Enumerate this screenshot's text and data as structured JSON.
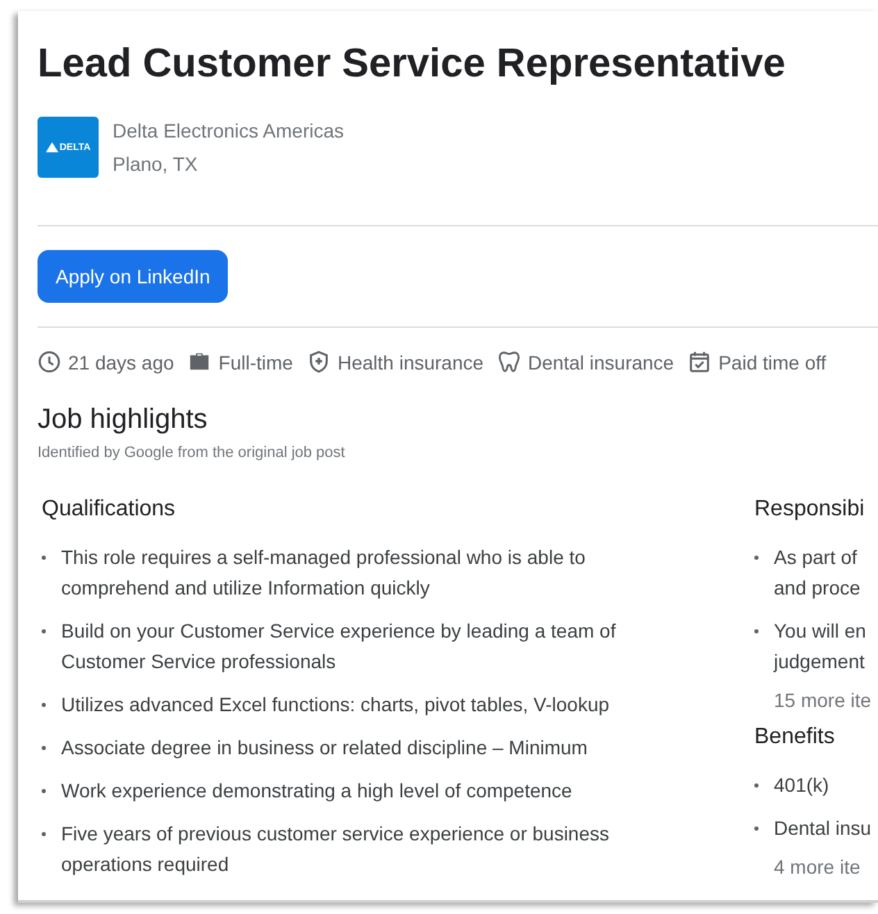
{
  "job": {
    "title": "Lead Customer Service Representative",
    "company": "Delta Electronics Americas",
    "location": "Plano, TX",
    "logo_text": "DELTA"
  },
  "apply_button": "Apply on LinkedIn",
  "chips": [
    {
      "kind": "clock",
      "label": "21 days ago"
    },
    {
      "kind": "briefcase",
      "label": "Full-time"
    },
    {
      "kind": "shield",
      "label": "Health insurance"
    },
    {
      "kind": "tooth",
      "label": "Dental insurance"
    },
    {
      "kind": "calendar",
      "label": "Paid time off"
    }
  ],
  "highlights": {
    "title": "Job highlights",
    "subtitle": "Identified by Google from the original job post",
    "left": [
      {
        "heading": "Qualifications",
        "items": [
          "This role requires a self-managed professional who is able to comprehend and utilize Information quickly",
          "Build on your Customer Service experience by leading a team of Customer Service professionals",
          "Utilizes advanced Excel functions: charts, pivot tables, V-lookup",
          "Associate degree in business or related discipline – Minimum",
          "Work experience demonstrating a high level of competence",
          "Five years of previous customer service experience or business operations required"
        ]
      }
    ],
    "right": [
      {
        "heading": "Responsibi",
        "items": [
          [
            "As part of",
            "and proce"
          ],
          [
            "You will en",
            "judgement"
          ]
        ],
        "more": "15 more ite"
      },
      {
        "heading": "Benefits",
        "items": [
          [
            "401(k)"
          ],
          [
            "Dental insu"
          ]
        ],
        "more": "4 more ite"
      }
    ]
  }
}
